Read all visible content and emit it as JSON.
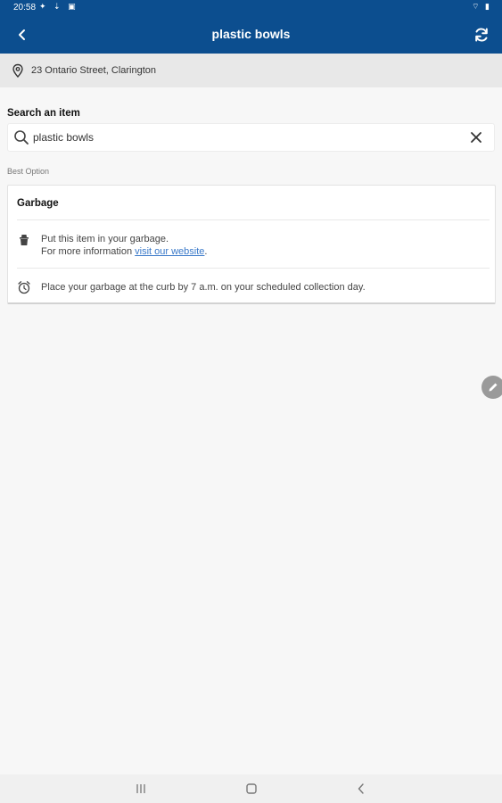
{
  "status_bar": {
    "time": "20:58",
    "left_icons": "✦ ⇣ ▣",
    "right_icons": "⌔ ▮"
  },
  "toolbar": {
    "title": "plastic bowls",
    "back_icon": "chevron-left-icon",
    "refresh_icon": "refresh-icon"
  },
  "location": {
    "icon": "location-pin-icon",
    "address": "23 Ontario Street, Clarington"
  },
  "search": {
    "label": "Search an item",
    "value": "plastic bowls",
    "icon": "search-icon",
    "clear_icon": "close-icon"
  },
  "result": {
    "section_label": "Best Option",
    "title": "Garbage",
    "instruction_line1": "Put this item in your garbage.",
    "instruction_line2_prefix": "For more information ",
    "link_text": "visit our website",
    "instruction_line2_suffix": ".",
    "schedule_text": "Place your garbage at the curb by 7 a.m. on your scheduled collection day."
  },
  "colors": {
    "brand": "#0c4e8f",
    "link": "#3a79c9",
    "background": "#f7f7f7"
  }
}
